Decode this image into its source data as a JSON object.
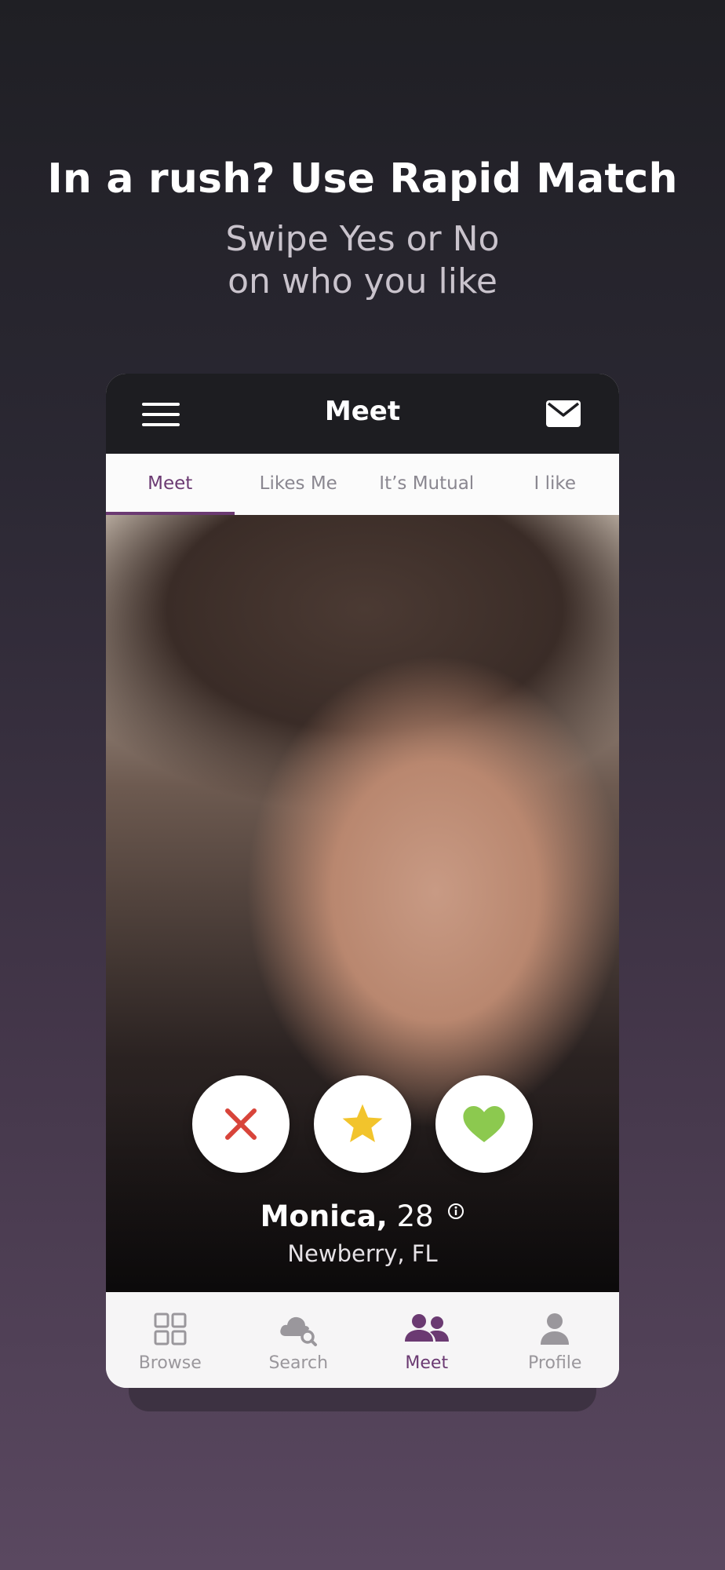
{
  "promo": {
    "headline": "In a rush? Use Rapid Match",
    "subline_1": "Swipe Yes or No",
    "subline_2": "on who you like"
  },
  "app": {
    "title": "Meet",
    "tabs": [
      {
        "label": "Meet",
        "active": true
      },
      {
        "label": "Likes Me",
        "active": false
      },
      {
        "label": "It’s Mutual",
        "active": false
      },
      {
        "label": "I like",
        "active": false
      }
    ],
    "profile": {
      "name": "Monica,",
      "age": "28",
      "location": "Newberry, FL"
    },
    "actions": [
      "close-icon",
      "star-icon",
      "heart-icon"
    ],
    "bottom_nav": [
      {
        "label": "Browse",
        "icon": "grid-icon",
        "active": false
      },
      {
        "label": "Search",
        "icon": "cloud-search-icon",
        "active": false
      },
      {
        "label": "Meet",
        "icon": "people-icon",
        "active": true
      },
      {
        "label": "Profile",
        "icon": "person-icon",
        "active": false
      }
    ]
  },
  "colors": {
    "accent": "#6b3a72",
    "no": "#d8443a",
    "star": "#f2c42c",
    "like": "#8cc94f"
  }
}
